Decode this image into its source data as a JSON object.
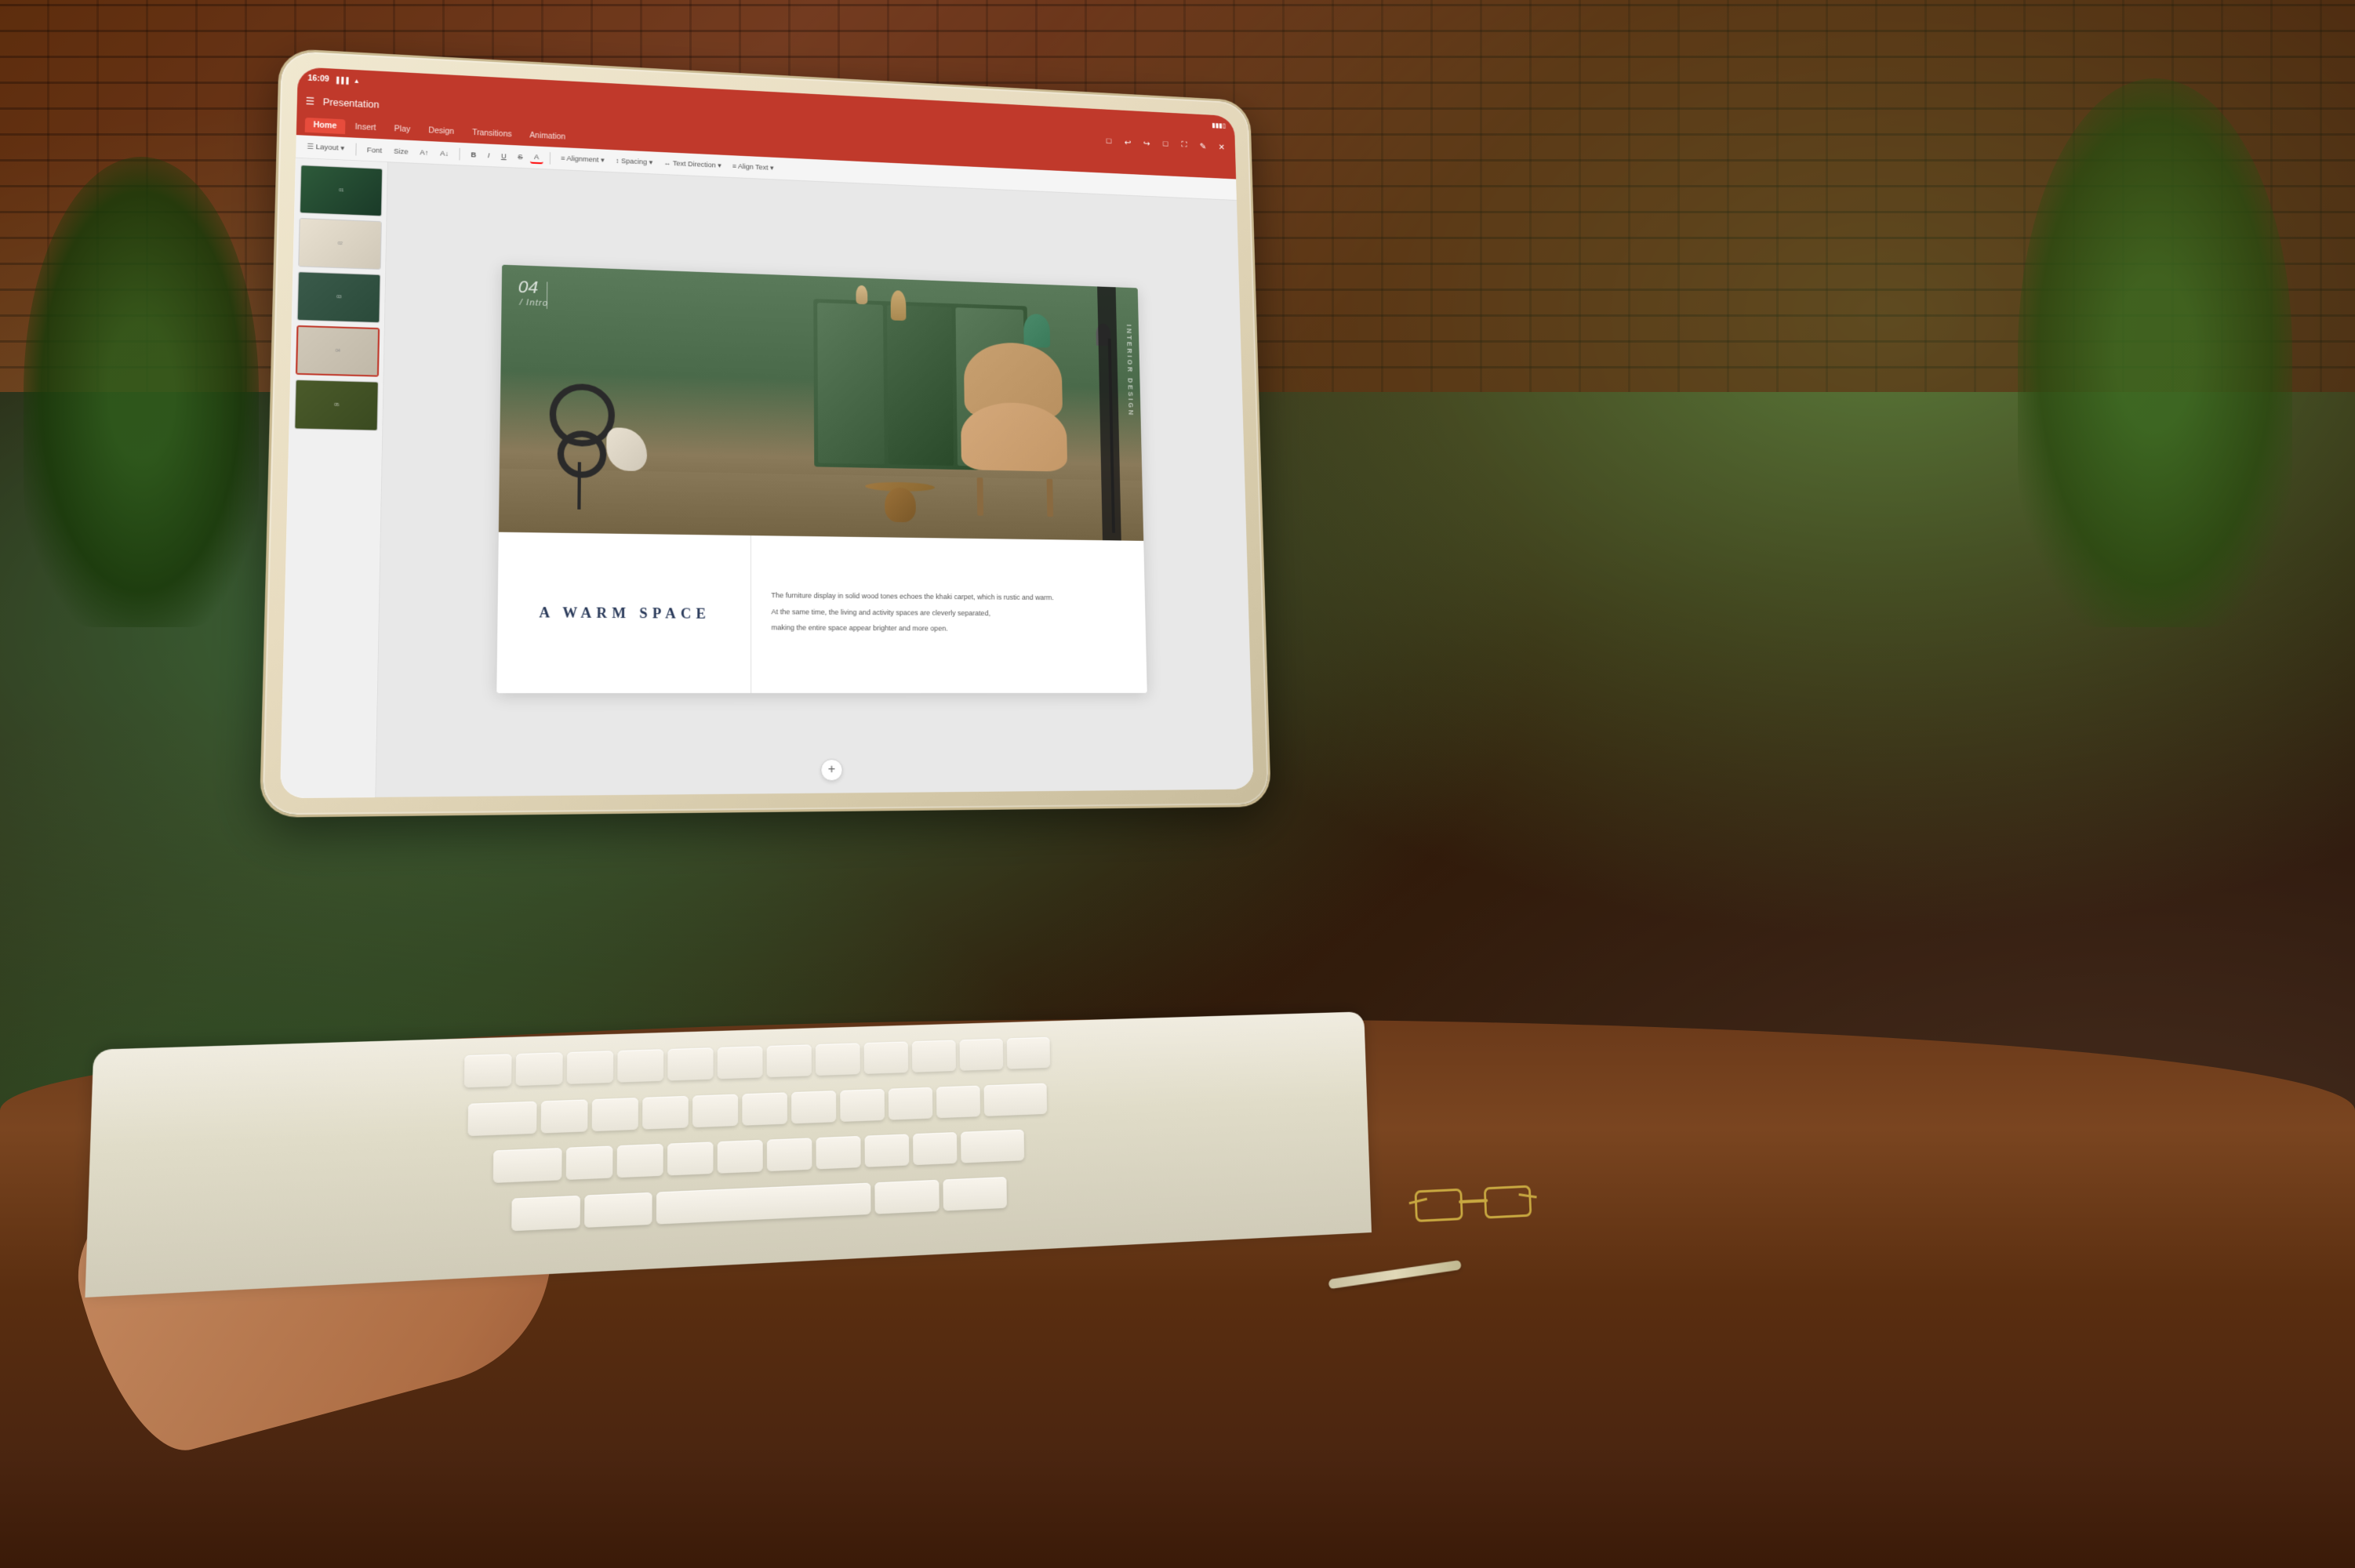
{
  "app": {
    "title": "Presentation",
    "status_time": "16:09",
    "battery": "▮▮▮▯",
    "wifi": "WiFi",
    "tabs": [
      {
        "label": "Home",
        "active": true
      },
      {
        "label": "Insert",
        "active": false
      },
      {
        "label": "Play",
        "active": false
      },
      {
        "label": "Design",
        "active": false
      },
      {
        "label": "Transitions",
        "active": false
      },
      {
        "label": "Animation",
        "active": false
      }
    ],
    "toolbar": {
      "layout_label": "☰ Layout ▾",
      "font_label": "Font",
      "size_label": "Size",
      "increase_font": "A↑",
      "decrease_font": "A↓",
      "bold": "B",
      "italic": "I",
      "underline": "U",
      "strikethrough": "S",
      "font_color": "A",
      "alignment_label": "≡ Alignment ▾",
      "spacing_label": "↕ Spacing ▾",
      "direction_label": "↔ Text Direction ▾",
      "align_text_label": "≡ Align Text ▾"
    }
  },
  "slide": {
    "number": "04",
    "intro_label": "/ Intro",
    "vertical_text": "INTERIOR DESIGN",
    "title": "A WARM SPACE",
    "description_line1": "The furniture display in solid wood tones echoes the khaki carpet, which is rustic and warm.",
    "description_line2": "At the same time, the living and activity spaces are cleverly separated,",
    "description_line3": "making the entire space appear brighter and more open."
  },
  "slides_panel": {
    "slides": [
      {
        "id": 1,
        "type": "dark-green",
        "active": false
      },
      {
        "id": 2,
        "type": "light-beige",
        "active": false
      },
      {
        "id": 3,
        "type": "dark-teal",
        "active": false
      },
      {
        "id": 4,
        "type": "current",
        "active": true
      },
      {
        "id": 5,
        "type": "dark-olive",
        "active": false
      }
    ],
    "add_button": "+"
  },
  "icons": {
    "menu": "☰",
    "undo": "↩",
    "redo": "↪",
    "minimize": "□",
    "fullscreen": "⛶",
    "edit": "✎",
    "close": "✕",
    "bold": "B",
    "italic": "I",
    "underline": "U",
    "strikethrough": "S",
    "plus": "+"
  },
  "colors": {
    "header_red": "#c0392b",
    "accent_red": "#e74c3c",
    "slide_text_blue": "#2a3a5a",
    "toolbar_bg": "#f5f5f5"
  }
}
